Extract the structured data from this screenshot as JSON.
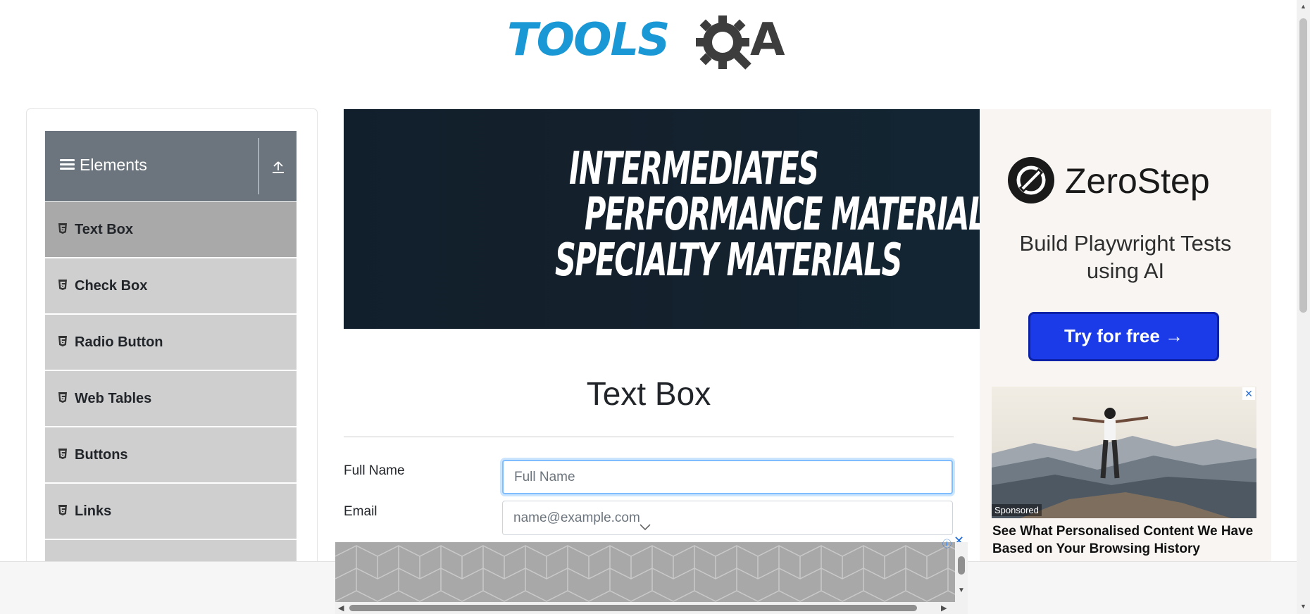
{
  "logo": {
    "text_tools": "TOOLS",
    "text_a": "A",
    "colors": {
      "tools": "#1a98d5",
      "qa": "#3d3d3d"
    }
  },
  "sidebar": {
    "group_title": "Elements",
    "items": [
      {
        "label": "Text Box",
        "active": true
      },
      {
        "label": "Check Box"
      },
      {
        "label": "Radio Button"
      },
      {
        "label": "Web Tables"
      },
      {
        "label": "Buttons"
      },
      {
        "label": "Links"
      }
    ]
  },
  "banner": {
    "line1": "INTERMEDIATES",
    "line2": "PERFORMANCE MATERIALS",
    "line3": "SPECIALTY MATERIALS"
  },
  "main": {
    "title": "Text Box",
    "full_name_label": "Full Name",
    "full_name_placeholder": "Full Name",
    "email_label": "Email",
    "email_placeholder": "name@example.com"
  },
  "ad_right": {
    "brand": "ZeroStep",
    "tagline": "Build Playwright Tests using AI",
    "cta": "Try for free →",
    "sponsored": "Sponsored",
    "headline": "See What Personalised Content We Have Based on Your Browsing History",
    "accent": "#1b3be8"
  },
  "icons": [
    "hamburger-icon",
    "collapse-icon",
    "html5-icon",
    "close-icon",
    "info-icon",
    "chevron-down-icon"
  ]
}
